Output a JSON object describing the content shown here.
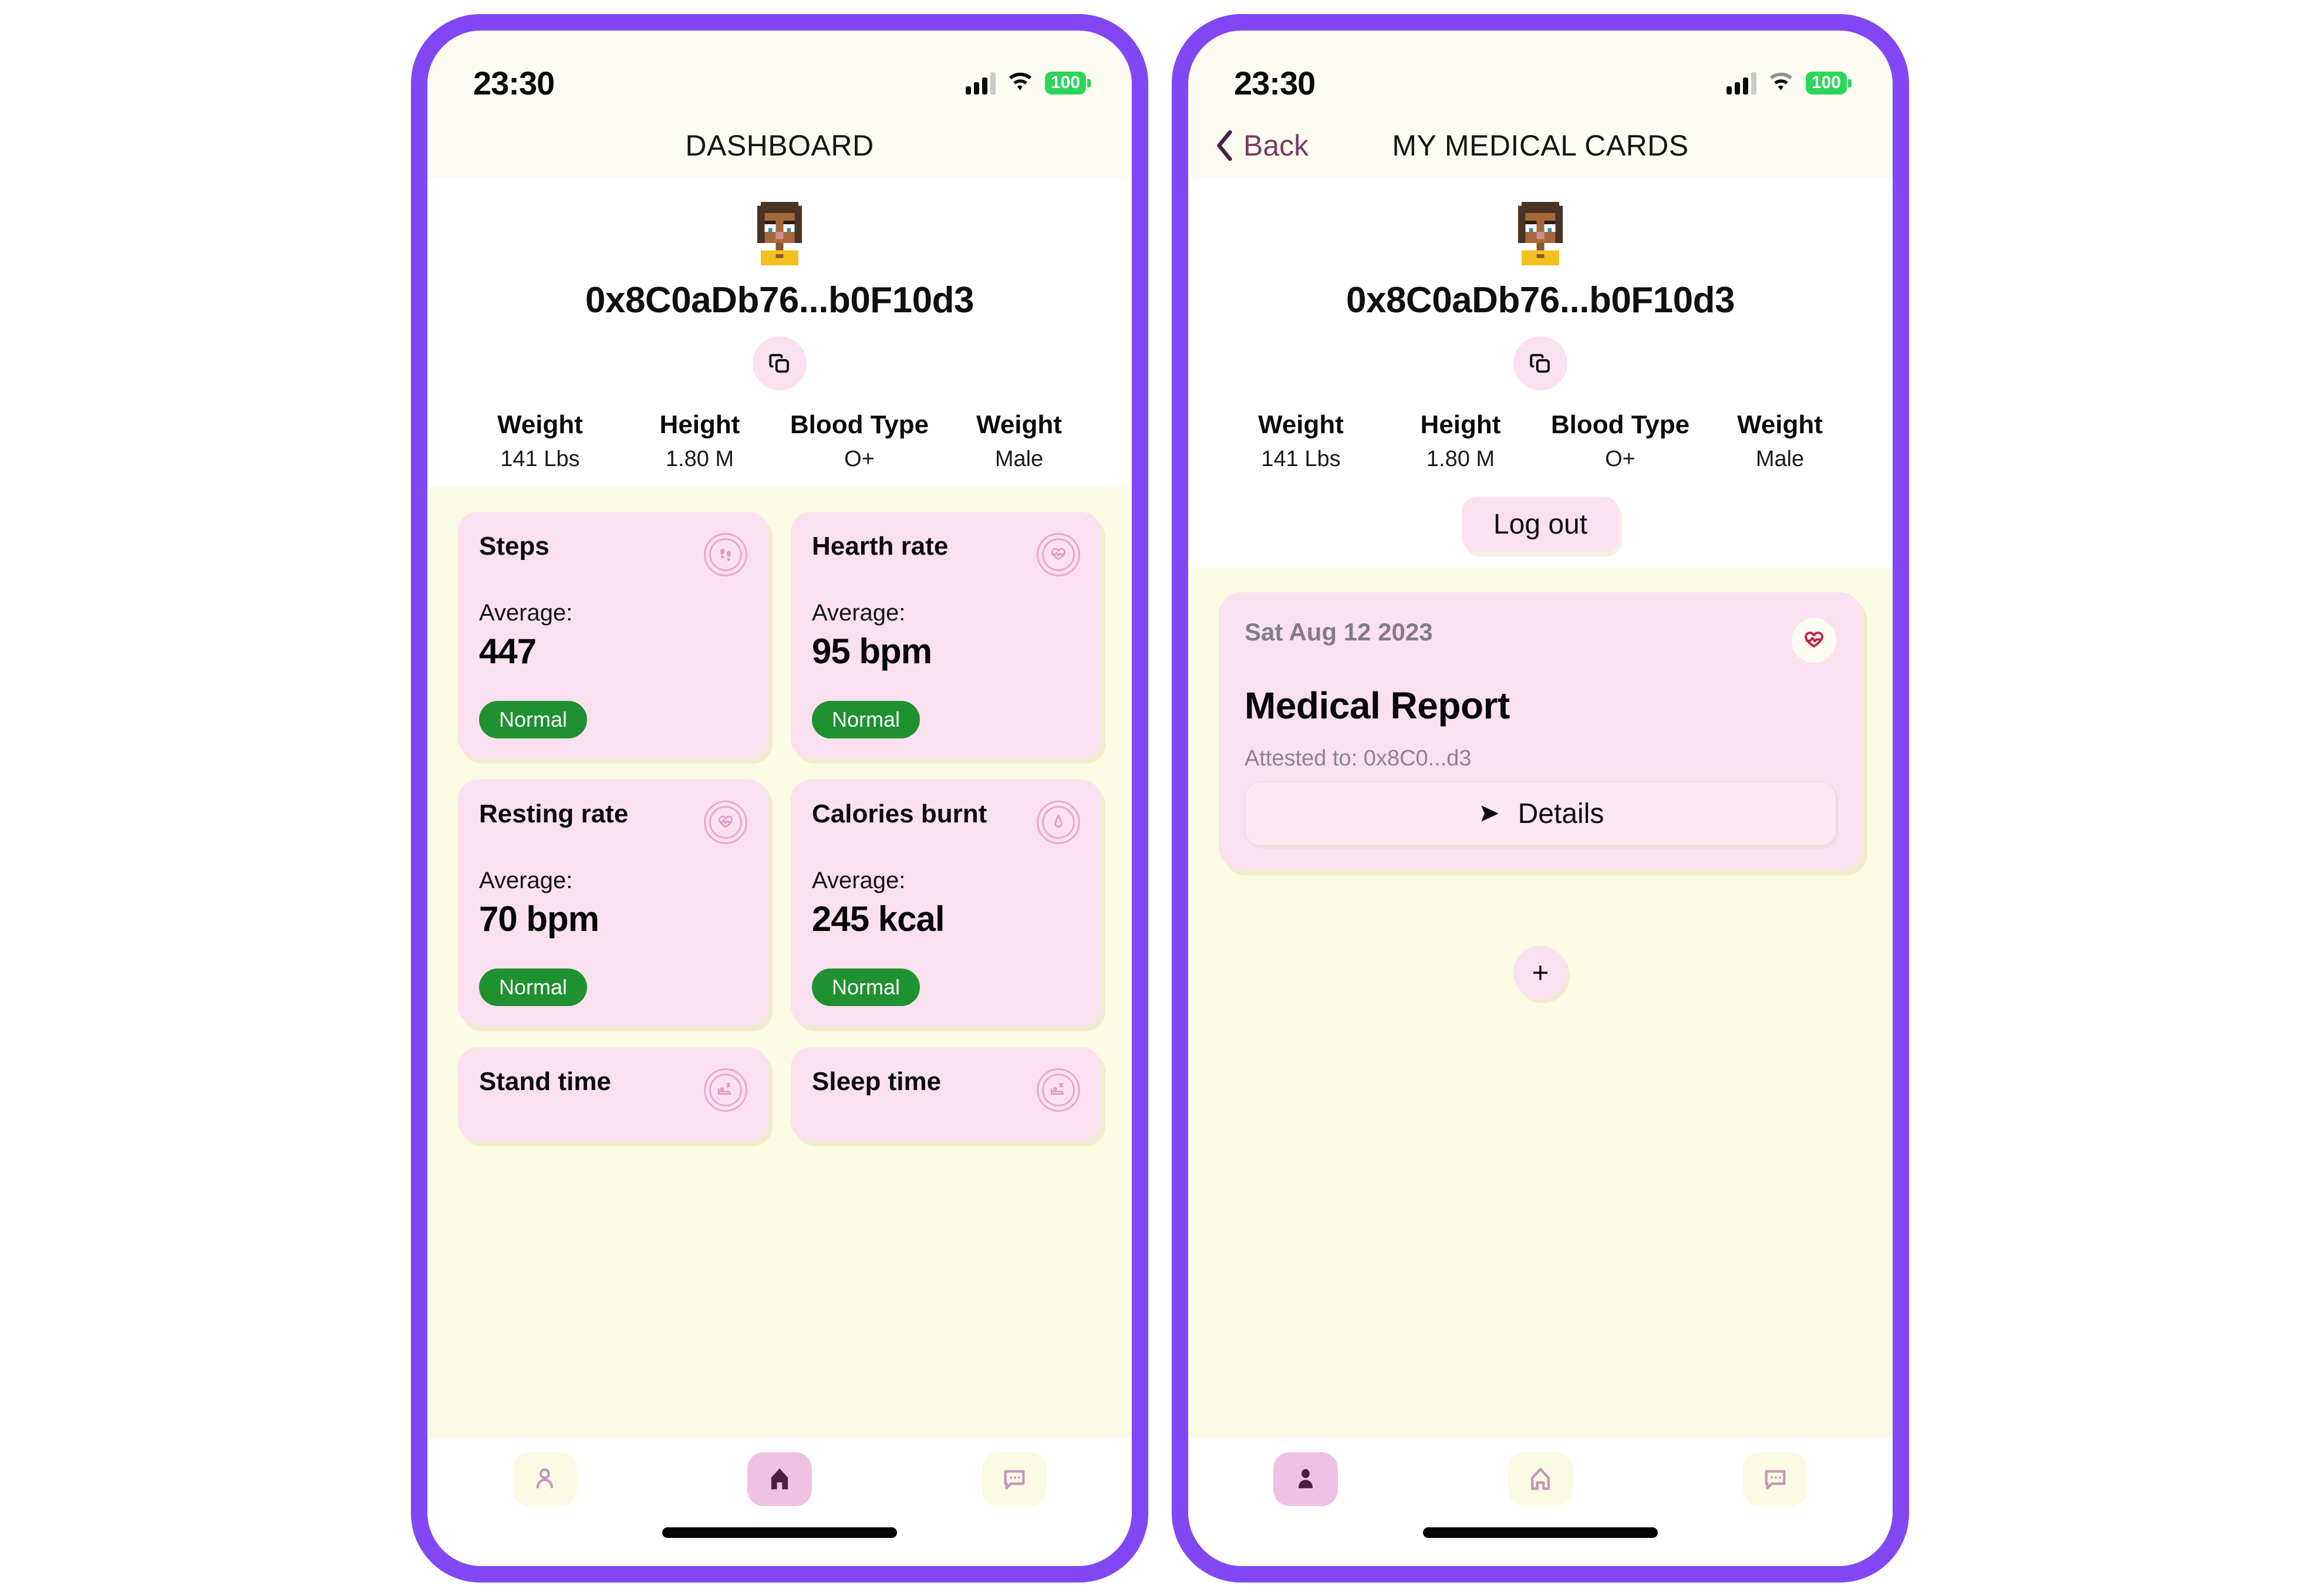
{
  "status_bar": {
    "time": "23:30",
    "battery": "100",
    "signal_icon": "signal-bars-icon",
    "wifi_icon": "wifi-icon",
    "battery_icon": "battery-icon"
  },
  "colors": {
    "phone_frame": "#8247F5",
    "screen_bg": "#FDFCF3",
    "content_bg": "#FBFBE4",
    "card_pink": "#FBE1F0",
    "badge_green": "#1F9130",
    "battery_green": "#2BD659",
    "accent_mauve": "#7B3A63",
    "icon_outline": "#E7A8CD",
    "tab_active": "#EEC2E0",
    "heart_red": "#C2234B"
  },
  "profile": {
    "avatar_icon": "pixel-avatar-icon",
    "wallet_address": "0x8C0aDb76...b0F10d3",
    "copy_icon": "copy-icon",
    "stats": [
      {
        "label": "Weight",
        "value": "141 Lbs"
      },
      {
        "label": "Height",
        "value": "1.80 M"
      },
      {
        "label": "Blood Type",
        "value": "O+"
      },
      {
        "label": "Weight",
        "value": "Male"
      }
    ]
  },
  "phone_left": {
    "nav": {
      "title": "DASHBOARD"
    },
    "metrics": [
      {
        "title": "Steps",
        "average_label": "Average:",
        "value": "447",
        "status": "Normal",
        "icon": "footprints-icon"
      },
      {
        "title": "Hearth rate",
        "average_label": "Average:",
        "value": "95 bpm",
        "status": "Normal",
        "icon": "heart-pulse-icon"
      },
      {
        "title": "Resting rate",
        "average_label": "Average:",
        "value": "70 bpm",
        "status": "Normal",
        "icon": "heart-pulse-icon"
      },
      {
        "title": "Calories burnt",
        "average_label": "Average:",
        "value": "245 kcal",
        "status": "Normal",
        "icon": "flame-kcal-icon"
      },
      {
        "title": "Stand time",
        "icon": "bed-sleep-icon"
      },
      {
        "title": "Sleep time",
        "icon": "bed-sleep-icon"
      }
    ],
    "tabs": [
      {
        "icon": "person-icon",
        "active": false
      },
      {
        "icon": "home-icon",
        "active": true
      },
      {
        "icon": "chat-bubble-icon",
        "active": false
      }
    ]
  },
  "phone_right": {
    "nav": {
      "back_label": "Back",
      "back_icon": "chevron-left-icon",
      "title": "MY MEDICAL CARDS"
    },
    "logout_label": "Log out",
    "report": {
      "date": "Sat Aug 12 2023",
      "title": "Medical Report",
      "attested": "Attested to: 0x8C0...d3",
      "details_label": "Details",
      "details_icon": "send-arrow-icon",
      "badge_icon": "heart-pulse-icon"
    },
    "fab_label": "+",
    "fab_icon": "plus-icon",
    "tabs": [
      {
        "icon": "person-icon",
        "active": true
      },
      {
        "icon": "home-icon",
        "active": false
      },
      {
        "icon": "chat-bubble-icon",
        "active": false
      }
    ]
  }
}
